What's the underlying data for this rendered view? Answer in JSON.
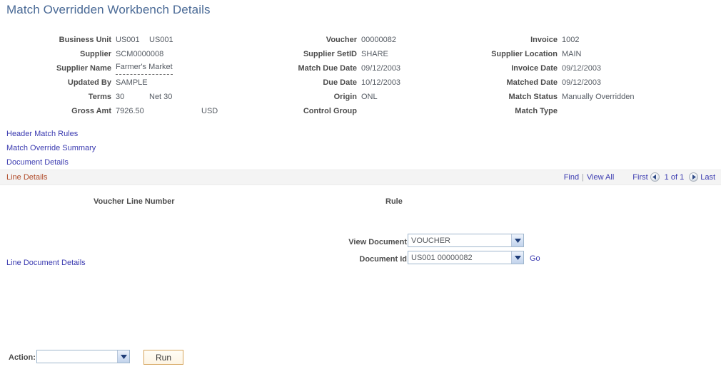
{
  "page": {
    "title": "Match Overridden Workbench Details"
  },
  "header": {
    "columns": [
      {
        "fields": [
          {
            "label": "Business Unit",
            "value": "US001",
            "value2": "US001"
          },
          {
            "label": "Supplier",
            "value": "SCM0000008",
            "value2": ""
          },
          {
            "label": "Supplier Name",
            "value": "Farmer's Market",
            "value2": ""
          },
          {
            "label": "Updated By",
            "value": "SAMPLE",
            "value2": ""
          },
          {
            "label": "Terms",
            "value": "30",
            "value2": "Net 30"
          },
          {
            "label": "Gross Amt",
            "value": "7926.50",
            "value2": "USD"
          }
        ]
      },
      {
        "fields": [
          {
            "label": "Voucher",
            "value": "00000082",
            "value2": ""
          },
          {
            "label": "Supplier SetID",
            "value": "SHARE",
            "value2": ""
          },
          {
            "label": "Match Due Date",
            "value": "09/12/2003",
            "value2": ""
          },
          {
            "label": "Due Date",
            "value": "10/12/2003",
            "value2": ""
          },
          {
            "label": "Origin",
            "value": "ONL",
            "value2": ""
          },
          {
            "label": "Control Group",
            "value": "",
            "value2": ""
          }
        ]
      },
      {
        "fields": [
          {
            "label": "Invoice",
            "value": "1002",
            "value2": ""
          },
          {
            "label": "Supplier Location",
            "value": "MAIN",
            "value2": ""
          },
          {
            "label": "Invoice Date",
            "value": "09/12/2003",
            "value2": ""
          },
          {
            "label": "Matched Date",
            "value": "09/12/2003",
            "value2": ""
          },
          {
            "label": "Match Status",
            "value": "Manually Overridden",
            "value2": ""
          },
          {
            "label": "Match Type",
            "value": "",
            "value2": ""
          }
        ]
      }
    ]
  },
  "section_links": [
    {
      "label": "Header Match Rules"
    },
    {
      "label": "Match Override Summary"
    },
    {
      "label": "Document Details"
    }
  ],
  "line_details": {
    "title": "Line Details",
    "nav": {
      "find": "Find",
      "separator": "|",
      "view_all": "View All",
      "first": "First",
      "counter": "1 of 1",
      "last": "Last",
      "prev_icon": "previous-arrow-icon",
      "next_icon": "next-arrow-icon"
    },
    "columns": [
      {
        "label": "Voucher Line Number"
      },
      {
        "label": "Rule"
      }
    ]
  },
  "document_panel": {
    "line_document_details_link": "Line Document Details",
    "view_document": {
      "label": "View Document",
      "value": "VOUCHER",
      "options": [
        "VOUCHER"
      ]
    },
    "document_id": {
      "label": "Document Id",
      "value": "US001 00000082",
      "options": [
        "US001 00000082"
      ]
    },
    "go_link": "Go"
  },
  "footer": {
    "action_label": "Action:",
    "action_value": "",
    "action_placeholder": "",
    "action_options": [],
    "run_label": "Run"
  },
  "colors": {
    "title": "#4a6a96",
    "link": "#3a3ab0",
    "active_section": "#b04a28",
    "label": "#4c4c4c",
    "value": "#555b63",
    "band": "#f4f4f4",
    "button_border": "#d6a55c",
    "select_border": "#9fb6cd"
  }
}
